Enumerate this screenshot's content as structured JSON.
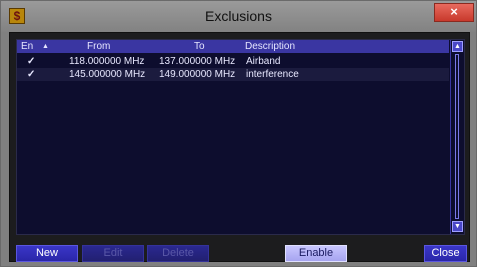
{
  "window": {
    "title": "Exclusions",
    "app_icon_glyph": "$",
    "close_glyph": "×"
  },
  "table": {
    "columns": {
      "enabled": "En",
      "sort_glyph": "▲",
      "from": "From",
      "to": "To",
      "description": "Description"
    },
    "rows": [
      {
        "enabled": "✓",
        "from": "118.000000 MHz",
        "to": "137.000000 MHz",
        "description": "Airband"
      },
      {
        "enabled": "✓",
        "from": "145.000000 MHz",
        "to": "149.000000 MHz",
        "description": "interference"
      }
    ],
    "scroll_up_glyph": "▲",
    "scroll_down_glyph": "▼"
  },
  "buttons": {
    "new": "New",
    "edit": "Edit",
    "delete": "Delete",
    "enable": "Enable",
    "close": "Close"
  },
  "colors": {
    "list_background": "#0d0d2e",
    "header_background": "#3a36a2",
    "button_accent": "#2a26a8",
    "client_background": "#1c1c1e"
  }
}
